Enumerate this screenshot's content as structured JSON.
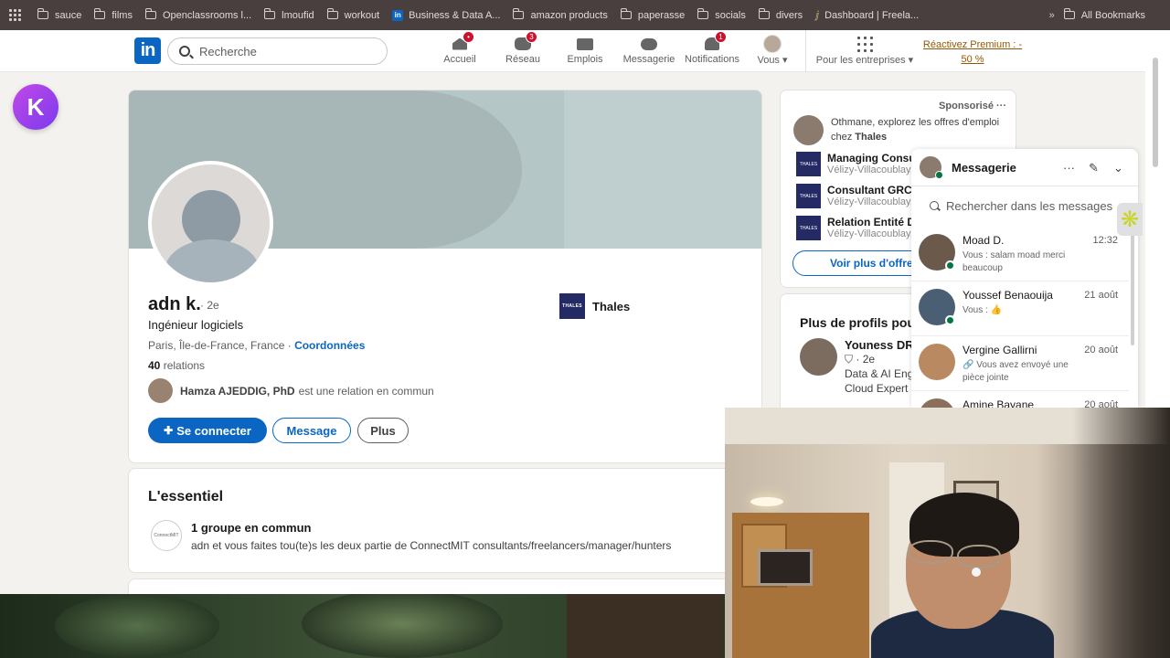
{
  "bookmarks": {
    "items": [
      "sauce",
      "films",
      "Openclassrooms l...",
      "lmoufid",
      "workout",
      "Business & Data A...",
      "amazon products",
      "paperasse",
      "socials",
      "divers",
      "Dashboard | Freela..."
    ],
    "all_label": "All Bookmarks",
    "overflow": "»"
  },
  "nav": {
    "logo": "in",
    "search_placeholder": "Recherche",
    "items": [
      {
        "label": "Accueil",
        "badge": "•",
        "icon": "home-icon"
      },
      {
        "label": "Réseau",
        "badge": "3",
        "icon": "network-icon"
      },
      {
        "label": "Emplois",
        "badge": "",
        "icon": "briefcase-icon"
      },
      {
        "label": "Messagerie",
        "badge": "",
        "icon": "chat-icon"
      },
      {
        "label": "Notifications",
        "badge": "1",
        "icon": "bell-icon"
      },
      {
        "label": "Vous ▾",
        "badge": "",
        "icon": "avatar"
      }
    ],
    "business": "Pour les entreprises ▾",
    "premium_line1": "Réactivez Premium : -",
    "premium_line2": "50 %"
  },
  "kbutton": "K",
  "profile": {
    "name": "adn k.",
    "degree": "· 2e",
    "headline": "Ingénieur logiciels",
    "location": "Paris, Île-de-France, France",
    "sep": " · ",
    "contact": "Coordonnées",
    "relations_count": "40",
    "relations_label": "relations",
    "mutual_name": "Hamza AJEDDIG, PhD",
    "mutual_text": "est une relation en commun",
    "company_logo": "THALES",
    "company": "Thales",
    "btn_connect": "Se connecter",
    "btn_message": "Message",
    "btn_more": "Plus"
  },
  "essentiel": {
    "title": "L'essentiel",
    "group_icon": "ConnectMIT",
    "group_title": "1 groupe en commun",
    "group_desc": "adn et vous faites tou(te)s les deux partie de ConnectMIT consultants/freelancers/manager/hunters"
  },
  "ad": {
    "sponsored": "Sponsorisé  ···",
    "intro_1": "Othmane, explorez les offres d'emploi",
    "intro_2": "chez ",
    "intro_company": "Thales",
    "jobs": [
      {
        "title": "Managing Consu",
        "loc": "Vélizy-Villacoublay,"
      },
      {
        "title": "Consultant GRC",
        "loc": "Vélizy-Villacoublay,"
      },
      {
        "title": "Relation Entité D",
        "loc": "Vélizy-Villacoublay,"
      }
    ],
    "more": "Voir plus d'offre"
  },
  "suggest": {
    "title": "Plus de profils pour",
    "name": "Youness DR",
    "degree": "· 2e",
    "desc1": "Data & AI Eng",
    "desc2": "Cloud Expert"
  },
  "messaging": {
    "title": "Messagerie",
    "search": "Rechercher dans les messages",
    "convs": [
      {
        "name": "Moad D.",
        "time": "12:32",
        "preview": "Vous : salam moad merci beaucoup",
        "online": true
      },
      {
        "name": "Youssef Benaouija",
        "time": "21 août",
        "preview": "Vous : 👍",
        "online": true
      },
      {
        "name": "Vergine Gallirni",
        "time": "20 août",
        "preview": "🔗 Vous avez envoyé une pièce jointe",
        "online": false
      },
      {
        "name": "Amine Bayane",
        "time": "20 août",
        "preview": "",
        "online": false
      }
    ]
  }
}
